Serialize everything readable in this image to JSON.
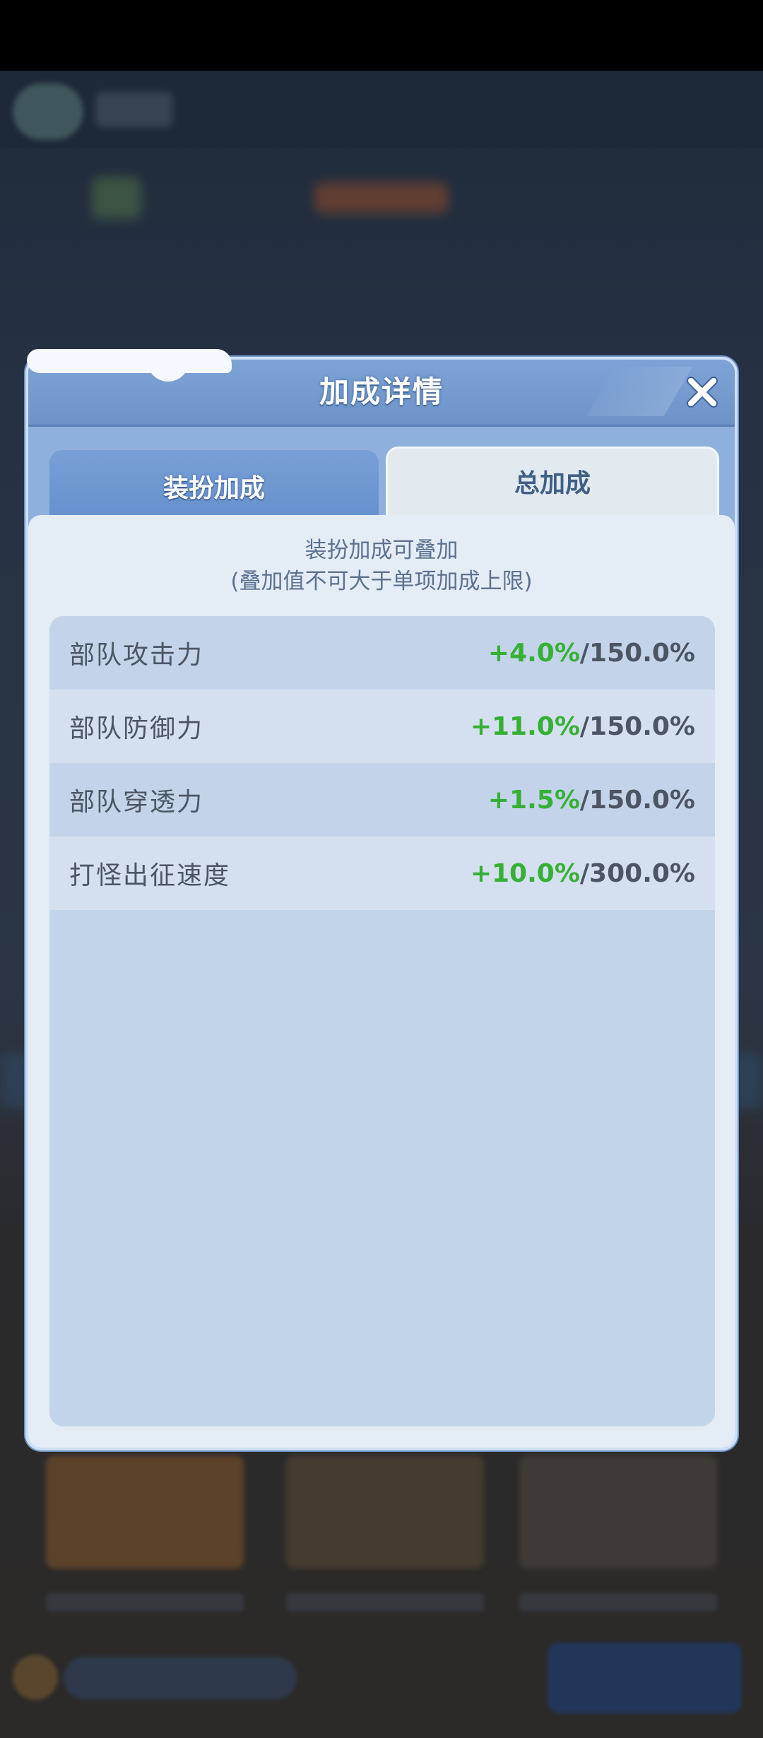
{
  "dialog": {
    "title": "加成详情",
    "tabs": [
      {
        "label": "装扮加成",
        "active": true
      },
      {
        "label": "总加成",
        "active": false
      }
    ],
    "description_line1": "装扮加成可叠加",
    "description_line2": "(叠加值不可大于单项加成上限)",
    "bonuses": [
      {
        "name": "部队攻击力",
        "value": "+4.0%",
        "limit": "/150.0%"
      },
      {
        "name": "部队防御力",
        "value": "+11.0%",
        "limit": "/150.0%"
      },
      {
        "name": "部队穿透力",
        "value": "+1.5%",
        "limit": "/150.0%"
      },
      {
        "name": "打怪出征速度",
        "value": "+10.0%",
        "limit": "/300.0%"
      }
    ]
  },
  "icons": {
    "close": "close-icon"
  },
  "colors": {
    "bonus_green": "#36b034",
    "title_white": "#ffffff",
    "panel_blue": "#8fb0dc"
  }
}
